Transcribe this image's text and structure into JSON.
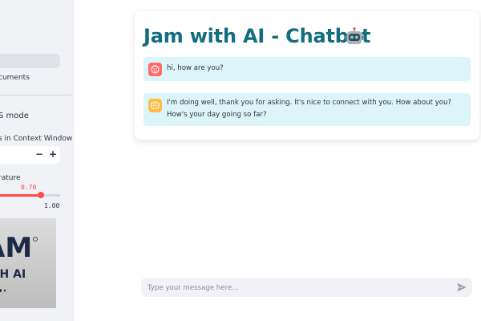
{
  "sidebar": {
    "documents_label": "cuments",
    "mode_label": "S mode",
    "context_label": "s in Context Window",
    "stepper": {
      "minus": "−",
      "plus": "+"
    },
    "temperature": {
      "label": "rature",
      "value_label": "0.70",
      "max_label": "1.00",
      "fraction": 0.7
    },
    "logo": {
      "alt": "JAM WITH AI",
      "line1": "AM",
      "line2": "TH AI"
    }
  },
  "chat": {
    "title": "Jam with AI - Chatbot",
    "title_icon": "robot-icon",
    "messages": [
      {
        "role": "user",
        "avatar": "user-avatar",
        "text": "hi, how are you?"
      },
      {
        "role": "assistant",
        "avatar": "assistant-avatar",
        "text": "I'm doing well, thank you for asking. It's nice to connect with you. How about you? How's your day going so far?"
      }
    ]
  },
  "input": {
    "placeholder": "Type your message here...",
    "value": "",
    "send_icon": "send-icon"
  },
  "colors": {
    "title": "#126e7e",
    "message_bg": "#dcf5f9",
    "user_avatar": "#ff6c6c",
    "assistant_avatar": "#ffbd45",
    "slider_accent": "#ff4b4b",
    "sidebar_bg": "#f0f2f6"
  }
}
